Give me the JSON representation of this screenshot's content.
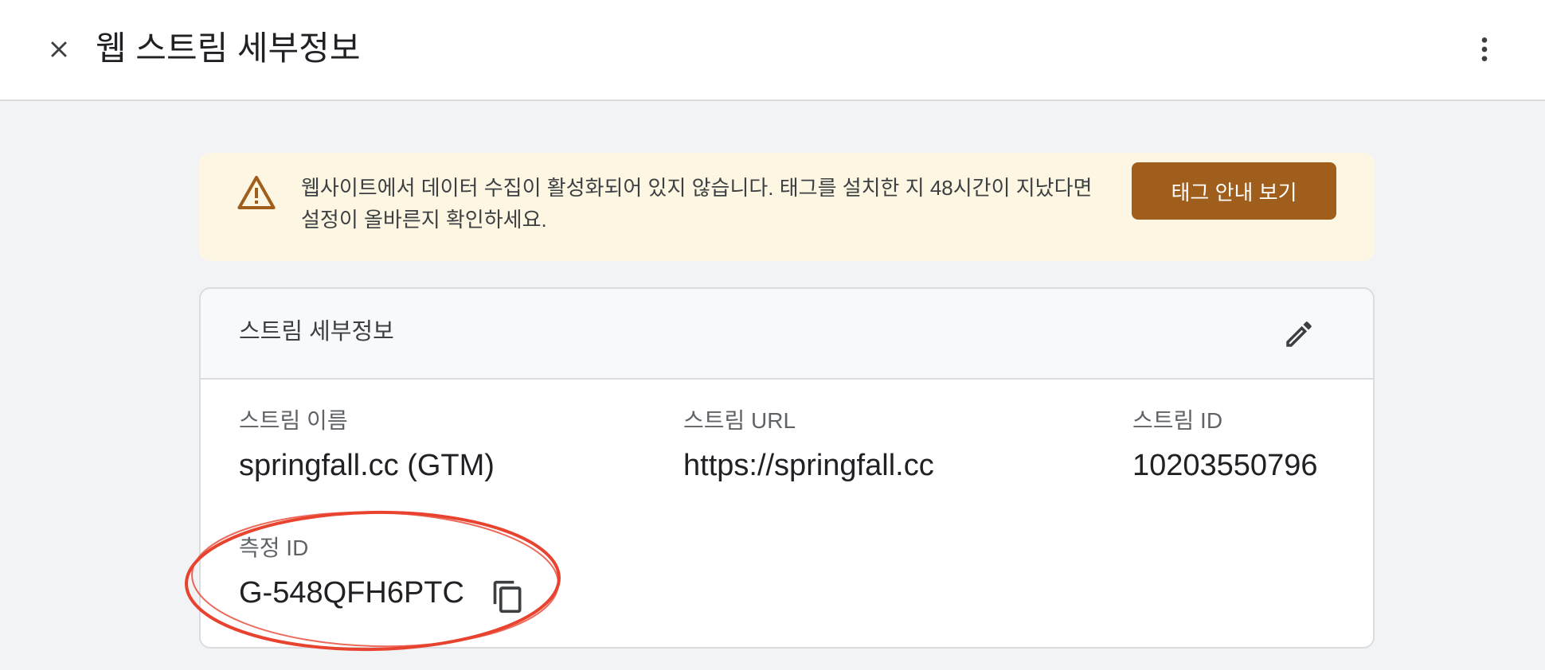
{
  "header": {
    "title": "웹 스트림 세부정보",
    "close_icon": "close-icon",
    "more_icon": "more-vert-icon"
  },
  "banner": {
    "icon": "warning-icon",
    "message": "웹사이트에서 데이터 수집이 활성화되어 있지 않습니다. 태그를 설치한 지 48시간이 지났다면 설정이 올바른지 확인하세요.",
    "button_label": "태그 안내 보기",
    "button_color": "#a05e1c",
    "background_color": "#fdf6e2"
  },
  "stream_details": {
    "title": "스트림 세부정보",
    "edit_icon": "edit-icon",
    "fields": {
      "name": {
        "label": "스트림 이름",
        "value": "springfall.cc (GTM)"
      },
      "url": {
        "label": "스트림 URL",
        "value": "https://springfall.cc"
      },
      "id": {
        "label": "스트림 ID",
        "value": "10203550796"
      },
      "measurement_id": {
        "label": "측정 ID",
        "value": "G-548QFH6PTC",
        "copy_icon": "copy-icon"
      }
    }
  },
  "annotation": {
    "shape": "hand-drawn-ellipse",
    "color": "#e8432f"
  }
}
